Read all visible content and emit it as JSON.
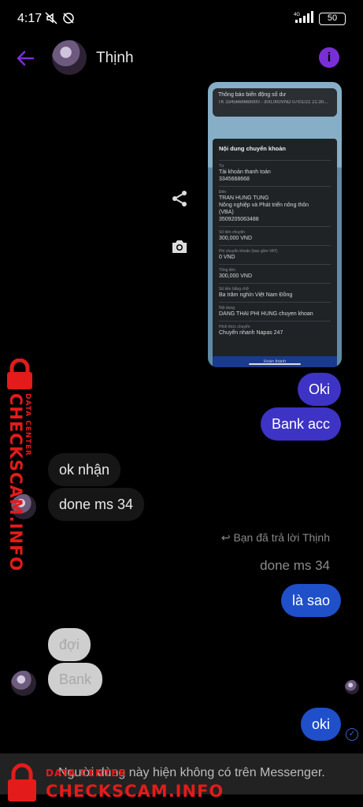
{
  "status_bar": {
    "time": "4:17",
    "network": "4G",
    "battery": "50"
  },
  "header": {
    "contact_name": "Thịnh"
  },
  "receipt": {
    "notification_title": "Thông báo biến động số dư",
    "notification_body": "TK 3345668668000 - 300,000VND 07/01/21 21:30...",
    "card_title": "Nội dung chuyển khoản",
    "rows": [
      {
        "label": "Từ",
        "value": "Tài khoản thanh toán\n3345668668"
      },
      {
        "label": "Đến",
        "value": "TRAN HUNG TUNG\nNông nghiệp và Phát triển nông thôn\n(VBA)\n3509205063488"
      },
      {
        "label": "Số tiền chuyển",
        "value": "300,000 VND"
      },
      {
        "label": "Phí chuyển khoản (bao gồm VAT)",
        "value": "0 VND"
      },
      {
        "label": "Tổng tiền",
        "value": "300,000 VND"
      },
      {
        "label": "Số tiền bằng chữ",
        "value": "Ba trăm nghìn Việt Nam Đồng"
      },
      {
        "label": "Nội dung",
        "value": "DANG THAI PHI HUNG chuyen khoan"
      },
      {
        "label": "Hình thức chuyển",
        "value": "Chuyển nhanh Napas 247"
      }
    ],
    "button": "Hoàn thành"
  },
  "messages": {
    "out_oki": "Oki",
    "out_bank_acc": "Bank acc",
    "in_ok_nhan": "ok nhận",
    "in_done_ms": "done ms 34",
    "reply_note": "Bạn đã trả lời Thịnh",
    "quoted": "done ms 34",
    "out_la_sao": "là sao",
    "in_doi": "đợi",
    "in_bank": "Bank",
    "out_oki2": "oki"
  },
  "footer": {
    "text": "Người dùng này hiện không có trên Messenger."
  },
  "watermark": {
    "brand": "CHECKSCAM.INFO",
    "sub": "DATA CENTER"
  },
  "colors": {
    "accent": "#7a2fd6",
    "outgoing": "#3d33c4",
    "outgoing_alt": "#1f4fc9",
    "watermark": "#e31b1b"
  }
}
